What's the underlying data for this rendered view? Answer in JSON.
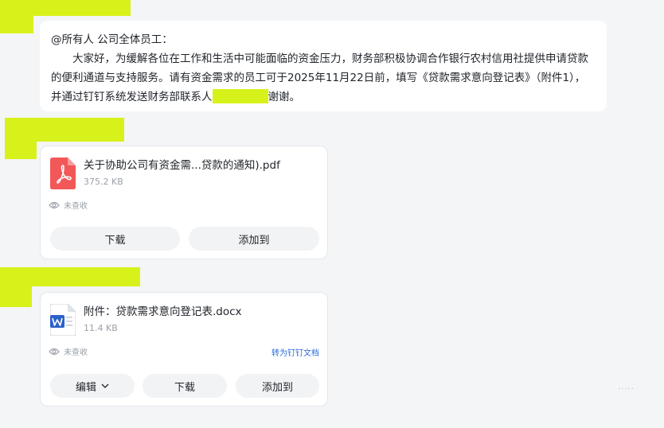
{
  "message": {
    "mention_line": "@所有人  公司全体员工：",
    "body_before_redaction": "大家好，为缓解各位在工作和生活中可能面临的资金压力，财务部积极协调合作银行农村信用社提供申请贷款的便利通道与支持服务。请有资金需求的员工可于2025年11月22日前，填写《贷款需求意向登记表》（附件1），并通过钉钉系统发送财务部联系人",
    "body_after_redaction": "谢谢。"
  },
  "attachments": [
    {
      "file_name": "关于协助公司有资金需...贷款的通知).pdf",
      "file_size": "375.2 KB",
      "file_type_icon": "pdf-icon",
      "read_status": "未查收",
      "buttons": {
        "download": "下载",
        "add_to": "添加到"
      }
    },
    {
      "file_name": "附件：贷款需求意向登记表.docx",
      "file_size": "11.4 KB",
      "file_type_icon": "word-docx-icon",
      "read_status": "未查收",
      "convert_link": "转为钉钉文档",
      "buttons": {
        "edit": "编辑",
        "download": "下载",
        "add_to": "添加到"
      }
    }
  ],
  "watermark": "·····",
  "colors": {
    "redaction": "#d7f21b",
    "pdf_red": "#f25858",
    "word_blue": "#2b62c9",
    "link_blue": "#2b6cd8"
  }
}
